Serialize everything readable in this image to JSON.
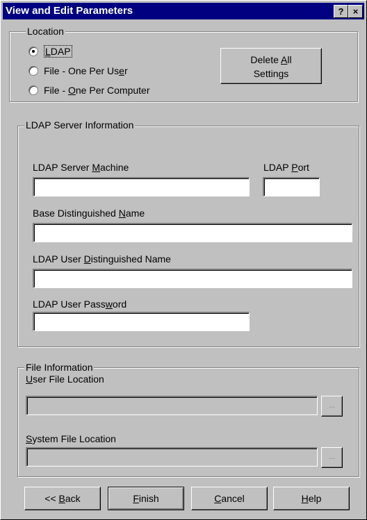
{
  "window": {
    "title": "View and Edit Parameters",
    "help_btn": "?",
    "close_btn": "×"
  },
  "location": {
    "legend": "Location",
    "options": [
      {
        "pre": "",
        "ul": "L",
        "post": "DAP",
        "checked": true
      },
      {
        "pre": "File - One Per Us",
        "ul": "e",
        "post": "r",
        "checked": false
      },
      {
        "pre": "File - ",
        "ul": "O",
        "post": "ne Per Computer",
        "checked": false
      }
    ],
    "delete_button": {
      "line1_pre": "Delete ",
      "line1_ul": "A",
      "line1_post": "ll",
      "line2": "Settings"
    }
  },
  "ldap": {
    "legend": "LDAP Server Information",
    "machine_label": {
      "pre": "LDAP Server ",
      "ul": "M",
      "post": "achine"
    },
    "port_label": {
      "pre": "LDAP ",
      "ul": "P",
      "post": "ort"
    },
    "base_dn_label": {
      "pre": "Base Distinguished ",
      "ul": "N",
      "post": "ame"
    },
    "user_dn_label": {
      "pre": "LDAP User ",
      "ul": "D",
      "post": "istinguished Name"
    },
    "password_label": {
      "pre": "LDAP User Pass",
      "ul": "w",
      "post": "ord"
    },
    "machine_value": "",
    "port_value": "",
    "base_dn_value": "",
    "user_dn_value": "",
    "password_value": ""
  },
  "file": {
    "legend": "File Information",
    "user_label": {
      "pre": "",
      "ul": "U",
      "post": "ser File Location"
    },
    "system_label": {
      "pre": "",
      "ul": "S",
      "post": "ystem File Location"
    },
    "user_value": "",
    "system_value": "",
    "browse": "..."
  },
  "buttons": {
    "back": {
      "pre": "<< ",
      "ul": "B",
      "post": "ack"
    },
    "finish": {
      "pre": "",
      "ul": "F",
      "post": "inish"
    },
    "cancel": {
      "pre": "",
      "ul": "C",
      "post": "ancel"
    },
    "help": {
      "pre": "",
      "ul": "H",
      "post": "elp"
    }
  }
}
